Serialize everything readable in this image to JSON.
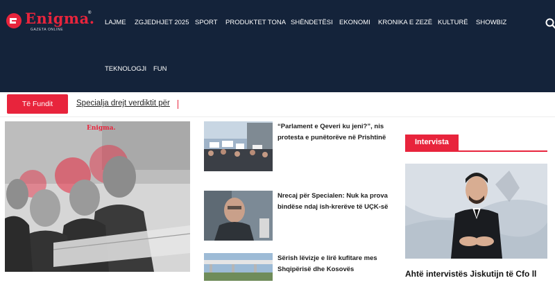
{
  "brand": {
    "name": "Enigma.",
    "registered": "®",
    "tagline": "GAZETA ONLINE"
  },
  "nav": {
    "items": [
      {
        "label": "LAJME"
      },
      {
        "label": "ZGJEDHJET 2025"
      },
      {
        "label": "SPORT"
      },
      {
        "label": "PRODUKTET TONA"
      },
      {
        "label": "SHËNDETËSI"
      },
      {
        "label": "EKONOMI"
      },
      {
        "label": "KRONIKA E ZEZË"
      },
      {
        "label": "KULTURË"
      },
      {
        "label": "SHOWBIZ"
      },
      {
        "label": "TEKNOLOGJI"
      },
      {
        "label": "FUN"
      }
    ]
  },
  "ticker": {
    "badge": "Të Fundit",
    "headline": "Specialja drejt verdiktit për"
  },
  "feature": {
    "watermark": "Enigma."
  },
  "articles": [
    {
      "title": "“Parlament e Qeveri ku jeni?”, nis protesta e punëtorëve në Prishtinë"
    },
    {
      "title": "Nrecaj për Specialen: Nuk ka prova bindëse ndaj ish-krerëve të UÇK-së"
    },
    {
      "title": "Sërish lëvizje e lirë kufitare mes Shqipërisë dhe Kosovës"
    }
  ],
  "sidebar": {
    "section_label": "Intervista",
    "interview_title": "Ahtë intervistës Jiskutijn të Cfo ll"
  },
  "colors": {
    "header_bg": "#14233a",
    "accent": "#e8243c"
  }
}
